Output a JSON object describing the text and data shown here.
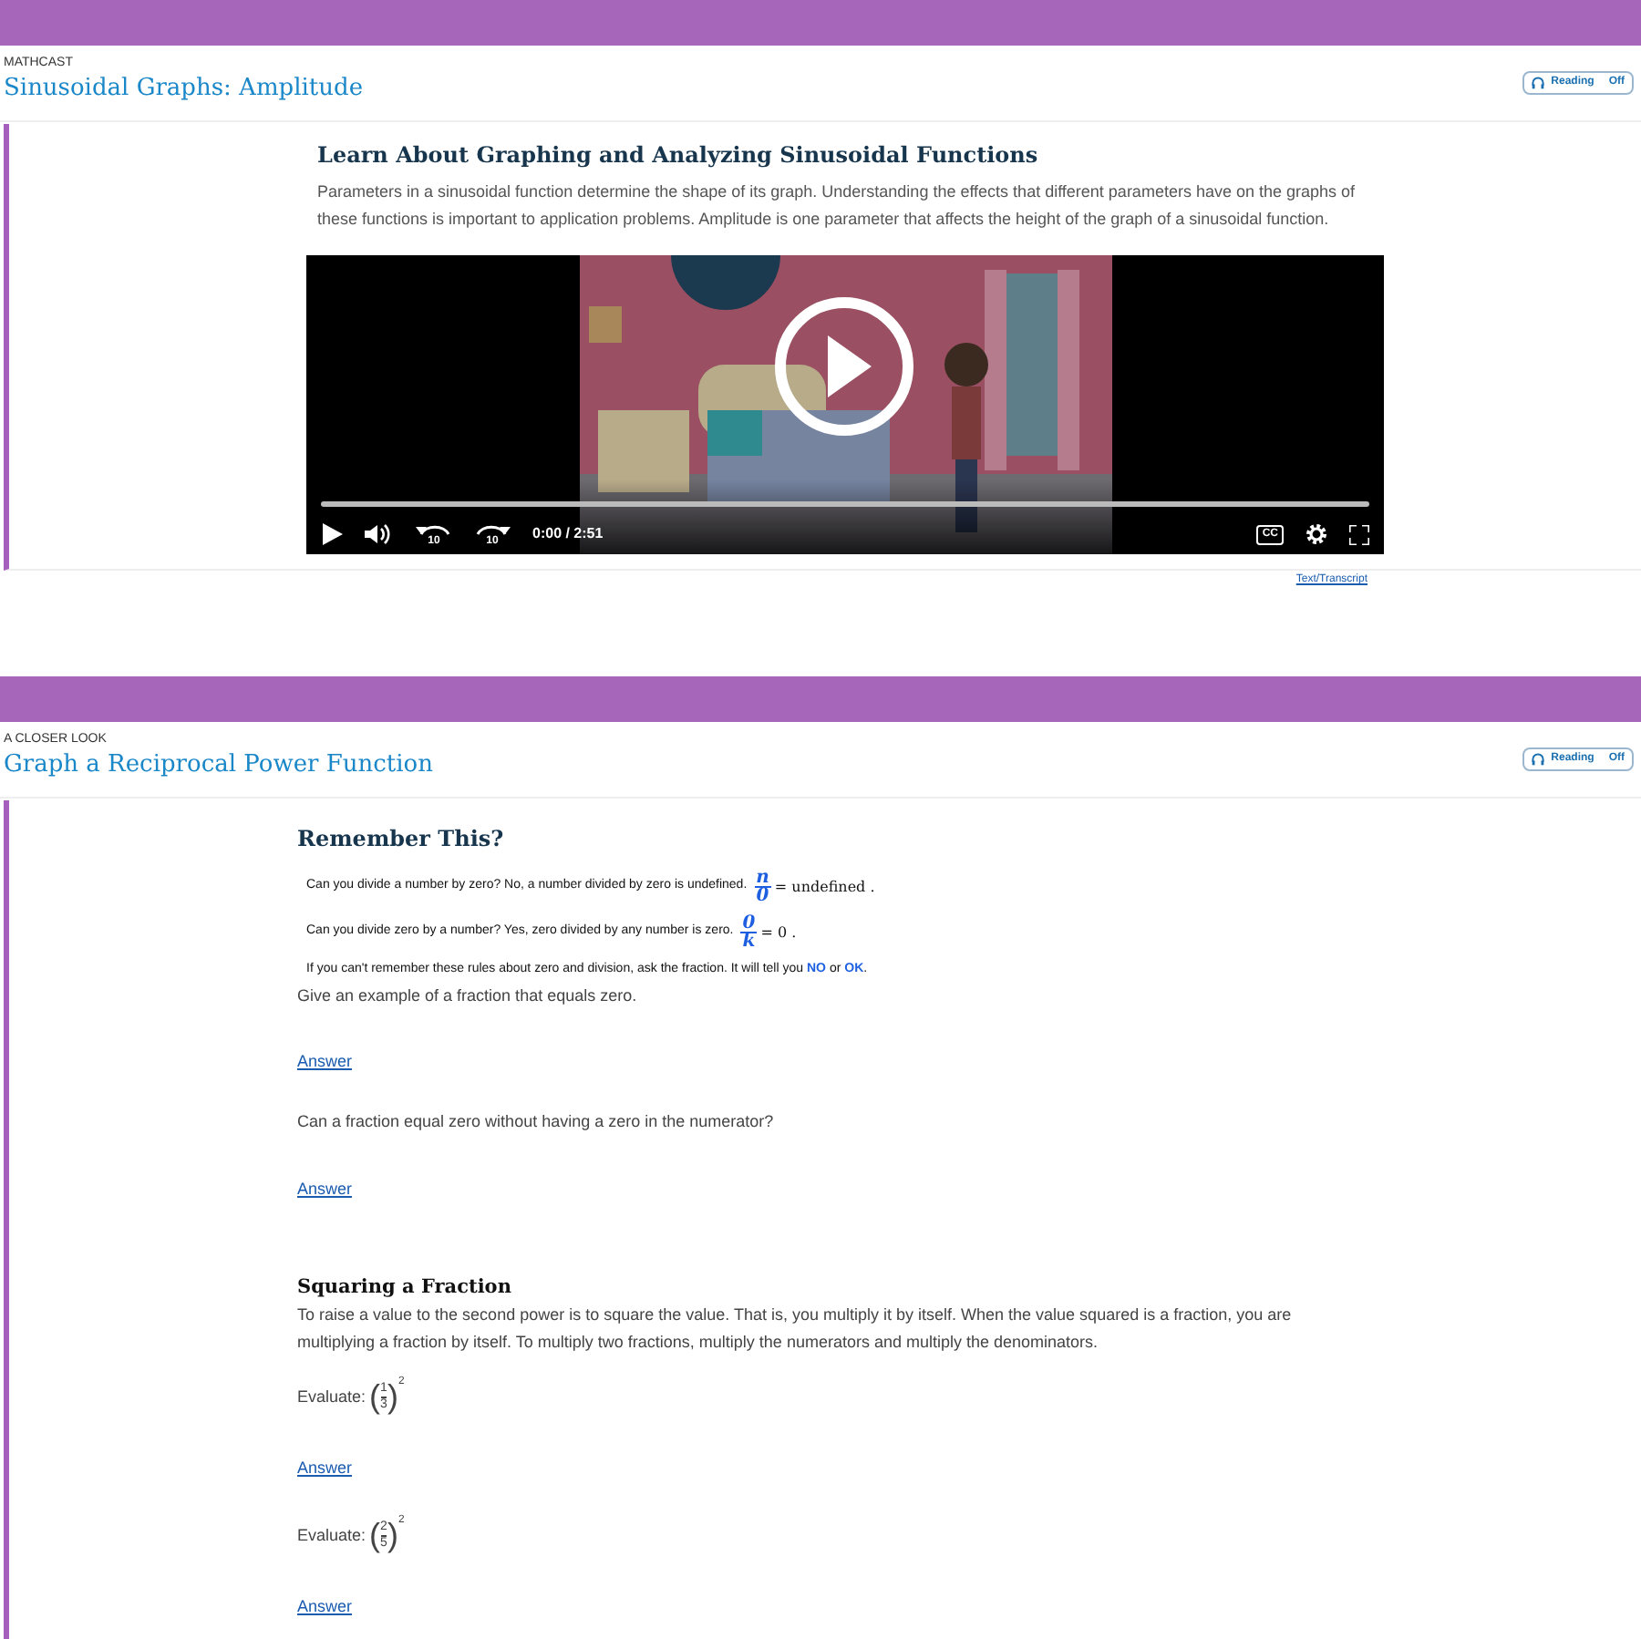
{
  "sections": [
    {
      "kind": "mathcast",
      "eyebrow": "MATHCAST",
      "title": "Sinusoidal Graphs: Amplitude",
      "reading": {
        "label": "Reading",
        "state": "Off",
        "on": false
      },
      "heading": "Learn About Graphing and Analyzing Sinusoidal Functions",
      "intro": "Parameters in a sinusoidal function determine the shape of its graph. Understanding the effects that different parameters have on the graphs of these functions is important to application problems. Amplitude is one parameter that affects the height of the graph of a sinusoidal function.",
      "video": {
        "level": 0,
        "rewind": "10",
        "forward": "10",
        "time": "0:00 / 2:51",
        "cc": "CC"
      },
      "transcript": "Text/Transcript"
    },
    {
      "kind": "closer",
      "eyebrow": "A CLOSER LOOK",
      "title": "Graph a Reciprocal Power Function",
      "reading": {
        "label": "Reading",
        "state": "Off",
        "on": false
      },
      "blocks": [
        {
          "kind": "heading",
          "text": "Remember This?"
        },
        {
          "kind": "note",
          "text": "Can you divide a number by zero? No, a number divided by zero is undefined.",
          "numerator": "n",
          "denominator": "0",
          "after": "= undefined ."
        },
        {
          "kind": "note",
          "text": "Can you divide zero by a number? Yes, zero divided by any number is zero.",
          "numerator": "0",
          "denominator": "k",
          "after": "= 0 ."
        },
        {
          "kind": "note_words",
          "text": "If you can't remember these rules about zero and division, ask the fraction. It will tell you",
          "no": "NO",
          "or": "or",
          "ok": "OK",
          "end": "."
        },
        {
          "kind": "para",
          "text": "Give an example of a fraction that equals zero."
        },
        {
          "kind": "link",
          "text": "Answer"
        },
        {
          "kind": "para",
          "text": "Can a fraction equal zero without having a zero in the numerator?"
        },
        {
          "kind": "link",
          "text": "Answer"
        },
        {
          "kind": "gap"
        },
        {
          "kind": "subheading",
          "text": "Squaring a Fraction"
        },
        {
          "kind": "para_tight",
          "text": "To raise a value to the second power is to square the value. That is, you multiply it by itself. When the value squared is a fraction, you are multiplying a fraction by itself. To multiply two fractions, multiply the numerators and multiply the denominators."
        },
        {
          "kind": "evaluate",
          "text": "Evaluate:",
          "open": "(",
          "numerator": "1",
          "denominator": "3",
          "close": ")",
          "exponent": "2"
        },
        {
          "kind": "link",
          "text": "Answer"
        },
        {
          "kind": "evaluate",
          "text": "Evaluate:",
          "open": "(",
          "numerator": "2",
          "denominator": "5",
          "close": ")",
          "exponent": "2"
        },
        {
          "kind": "link",
          "text": "Answer"
        }
      ]
    }
  ]
}
